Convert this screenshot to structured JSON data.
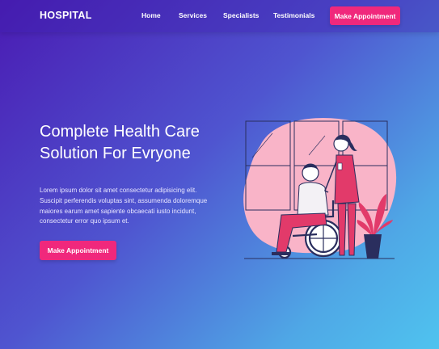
{
  "nav": {
    "brand": "HOSPITAL",
    "links": [
      "Home",
      "Services",
      "Specialists",
      "Testimonials"
    ],
    "cta": "Make Appointment"
  },
  "hero": {
    "title": "Complete Health Care Solution For Evryone",
    "body": "Lorem ipsum dolor sit amet consectetur adipisicing elit. Suscipit perferendis voluptas sint, assumenda doloremque maiores earum amet sapiente obcaecati iusto incidunt, consectetur error quo ipsum et.",
    "cta": "Make Appointment"
  },
  "colors": {
    "accent": "#f0287c",
    "blob": "#f9b4c8",
    "scrub": "#e23a6a"
  }
}
